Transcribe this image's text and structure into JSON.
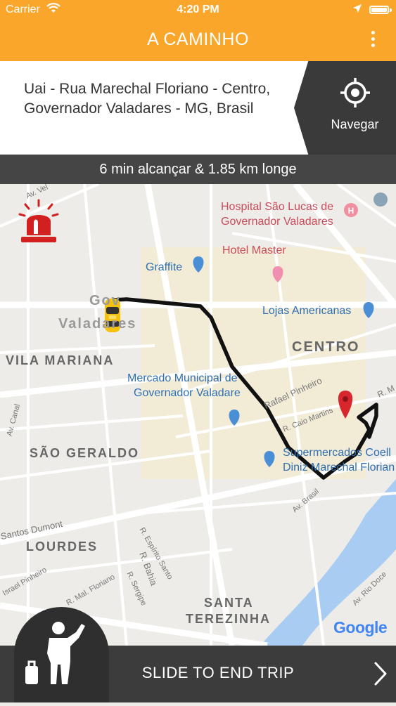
{
  "status_bar": {
    "carrier": "Carrier",
    "time": "4:20 PM"
  },
  "header": {
    "title": "A CAMINHO",
    "menu_icon": "more-vertical-icon"
  },
  "destination": {
    "address": "Uai - Rua Marechal Floriano - Centro, Governador Valadares - MG, Brasil",
    "navigate_label": "Navegar",
    "navigate_icon": "crosshair-icon"
  },
  "eta": {
    "text": "6 min alcançar & 1.85 km longe"
  },
  "map": {
    "pois_red": [
      "Hospital São Lucas de",
      "Governador Valadares",
      "Hotel Master"
    ],
    "pois_blue": [
      "Graffite",
      "Lojas Americanas",
      "Mercado Municipal de",
      "Governador Valadare",
      "Supermercados Coell",
      "Diniz Marechal Florian"
    ],
    "areas": [
      "Gov",
      "Valadares",
      "VILA MARIANA",
      "CENTRO",
      "SÃO GERALDO",
      "LOURDES",
      "SANTA",
      "TEREZINHA"
    ],
    "streets": [
      "Rafael Pinheiro",
      "R. Caio Martins",
      "Av. Brasil",
      "R. Bahia",
      "Santos Dumont",
      "R. Espírito Santo",
      "R. Mal. Floriano",
      "Israel Pinheiro",
      "Av. Canal",
      "R. Sergipe",
      "Av. Rio Doce",
      "R. M",
      "Av. Vel"
    ],
    "attribution": "Google",
    "route_color": "#111111",
    "accent": "#f9a62b"
  },
  "slider": {
    "label": "SLIDE TO END TRIP",
    "icon": "chevron-right-icon",
    "person_icon": "passenger-waving-icon"
  },
  "alarm": {
    "icon": "siren-alarm-icon"
  }
}
